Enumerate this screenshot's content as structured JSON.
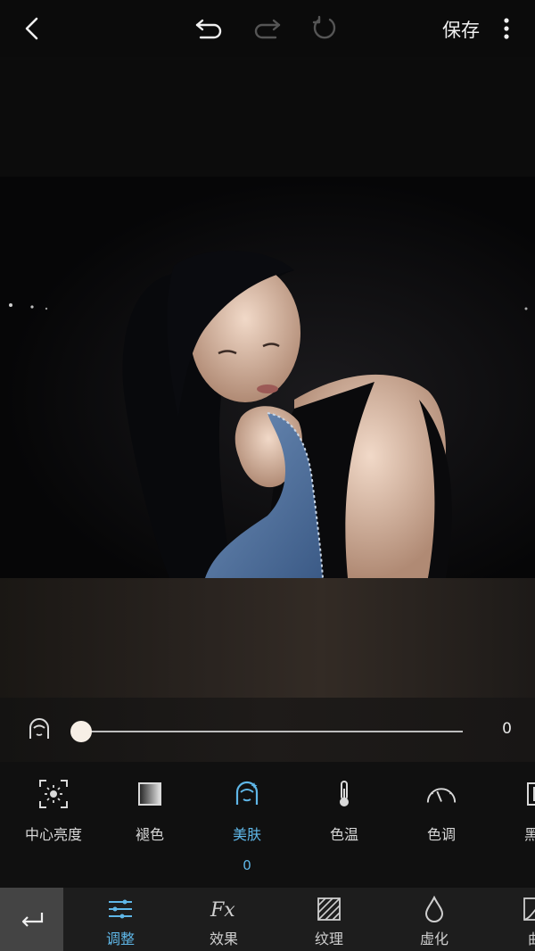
{
  "topbar": {
    "save_label": "保存"
  },
  "slider": {
    "value": "0",
    "level": 0
  },
  "tools": [
    {
      "label": "中心亮度",
      "icon": "center-brightness-icon"
    },
    {
      "label": "褪色",
      "icon": "fade-icon"
    },
    {
      "label": "美肤",
      "icon": "beauty-skin-icon",
      "active": true,
      "value": "0"
    },
    {
      "label": "色温",
      "icon": "thermometer-icon"
    },
    {
      "label": "色调",
      "icon": "tone-gauge-icon"
    },
    {
      "label": "黑白",
      "icon": "black-white-icon"
    }
  ],
  "tabs": [
    {
      "label": "调整",
      "icon": "sliders-icon",
      "active": true
    },
    {
      "label": "效果",
      "icon": "fx-icon"
    },
    {
      "label": "纹理",
      "icon": "texture-icon"
    },
    {
      "label": "虚化",
      "icon": "blur-drop-icon"
    },
    {
      "label": "曲",
      "icon": "curve-icon"
    }
  ],
  "colors": {
    "accent": "#5fb7e8",
    "background": "#0b0b0b",
    "toolbar": "#101010",
    "bottombar": "#1d1d1d"
  }
}
